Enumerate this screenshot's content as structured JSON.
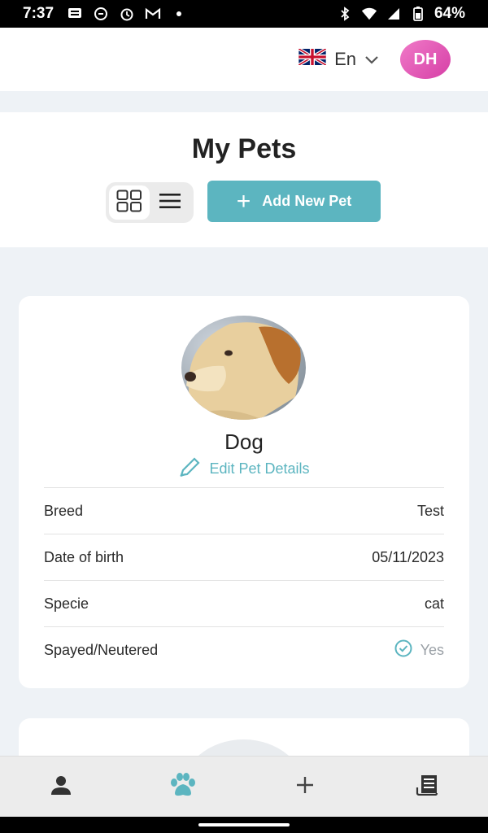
{
  "status_bar": {
    "time": "7:37",
    "battery": "64%"
  },
  "topbar": {
    "language": "En",
    "avatar_initials": "DH"
  },
  "header": {
    "title": "My Pets",
    "add_button_label": "Add New Pet"
  },
  "pet": {
    "name": "Dog",
    "edit_label": "Edit Pet Details",
    "details": [
      {
        "label": "Breed",
        "value": "Test"
      },
      {
        "label": "Date of birth",
        "value": "05/11/2023"
      },
      {
        "label": "Specie",
        "value": "cat"
      },
      {
        "label": "Spayed/Neutered",
        "value": "Yes"
      }
    ]
  },
  "colors": {
    "accent": "#5cb5c0",
    "avatar": "#e055b8",
    "background": "#eef2f6"
  },
  "icons": {
    "view_toggle": [
      "grid-view-icon",
      "list-view-icon"
    ],
    "bottom_nav": [
      "person-icon",
      "paw-icon",
      "plus-icon",
      "receipt-icon"
    ]
  }
}
